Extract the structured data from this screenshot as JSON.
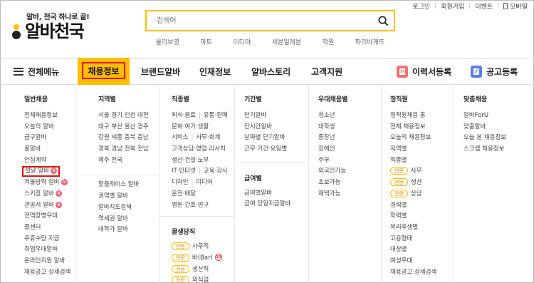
{
  "util": {
    "login": "로그인",
    "signup": "회원가입",
    "event": "이벤트",
    "mobile": "모바일"
  },
  "logo": {
    "tagline": "알바, 천국 하나로 끝!",
    "name": "알바천국"
  },
  "search": {
    "placeholder": "검색어",
    "keywords": [
      "올리브영",
      "마트",
      "이디야",
      "세븐일레븐",
      "학원",
      "파리바게뜨"
    ]
  },
  "gnb": {
    "all_menu": "전체메뉴",
    "active": "채용정보",
    "items": [
      "브랜드알바",
      "인재정보",
      "알바스토리",
      "고객지원"
    ],
    "resume": "이력서등록",
    "ad": "공고등록"
  },
  "colors": {
    "accent": "#ffbe00",
    "highlight": "#e21313",
    "badge": "#f0627b"
  },
  "mega": {
    "general": {
      "title": "일반채용",
      "items": [
        "전체채용정보",
        "오늘의 알바",
        "급구알바",
        "꿀알바",
        "안심계약",
        "설날 알바",
        "겨울방학 알바",
        "스키장 알바",
        "관공서 알바",
        "전역장병우대",
        "콜센터",
        "주휴수당 지급",
        "취업우대알바",
        "온라인지원 알바",
        "채용공고 상세검색"
      ],
      "new_badge": "N"
    },
    "region": {
      "title": "지역별",
      "grid": [
        [
          "서울",
          "경기",
          "인천",
          "대전"
        ],
        [
          "대구",
          "부산",
          "울산",
          "광주"
        ],
        [
          "강원",
          "세종",
          "충북",
          "충남"
        ],
        [
          "경북",
          "경남",
          "전북",
          "전남"
        ],
        [
          "제주",
          "전국"
        ]
      ],
      "items": [
        "핫플레이스 알바",
        "권역별 알바",
        "알바지도검색",
        "역세권 알바",
        "대학가 알바"
      ]
    },
    "job": {
      "title": "직종별",
      "pairs": [
        [
          "외식·음료",
          "유통·판매"
        ],
        [
          "문화·여가·생활"
        ],
        [
          "서비스",
          "사무·회계"
        ],
        [
          "고객상담·영업·리서치"
        ],
        [
          "생산·건설·노무"
        ],
        [
          "IT·인터넷",
          "교육·강사"
        ],
        [
          "디자인",
          "미디어"
        ],
        [
          "운전·배달"
        ],
        [
          "병원·간호·연구"
        ]
      ],
      "honey_title": "꿀생당직",
      "pill": "전문",
      "honey": [
        "사무직",
        "바(Bar)",
        "생산직",
        "외식업"
      ],
      "age_badge": "19"
    },
    "period": {
      "title": "기간별",
      "items": [
        "단기알바",
        "단시간알바",
        "날짜별 단기알바",
        "근무 기간·요일별"
      ],
      "pay_title": "급여별",
      "pay_items": [
        "급여별알바",
        "급여 당일지급알바"
      ]
    },
    "preferred": {
      "title": "우대채용별",
      "items": [
        "청소년",
        "대학생",
        "중장년",
        "장애인",
        "주부",
        "외국인가능",
        "초보가능",
        "재택가능"
      ]
    },
    "regular": {
      "title": "정직원",
      "items": [
        "정직원채용 홈",
        "전체 채용정보",
        "오늘의 채용정보",
        "지역별",
        "직종별"
      ],
      "pill": "전문",
      "pill_items": [
        "사무",
        "생산",
        "상담"
      ],
      "items2": [
        "경력별",
        "학력별",
        "복리후생별",
        "고용형태",
        "대상별",
        "여성우대",
        "채용공고 상세검색"
      ]
    },
    "custom": {
      "title": "맞춤채용",
      "items": [
        "알바ForU",
        "맞춤알바",
        "오늘 본 채용정보",
        "스크랩 채용정보"
      ]
    }
  }
}
